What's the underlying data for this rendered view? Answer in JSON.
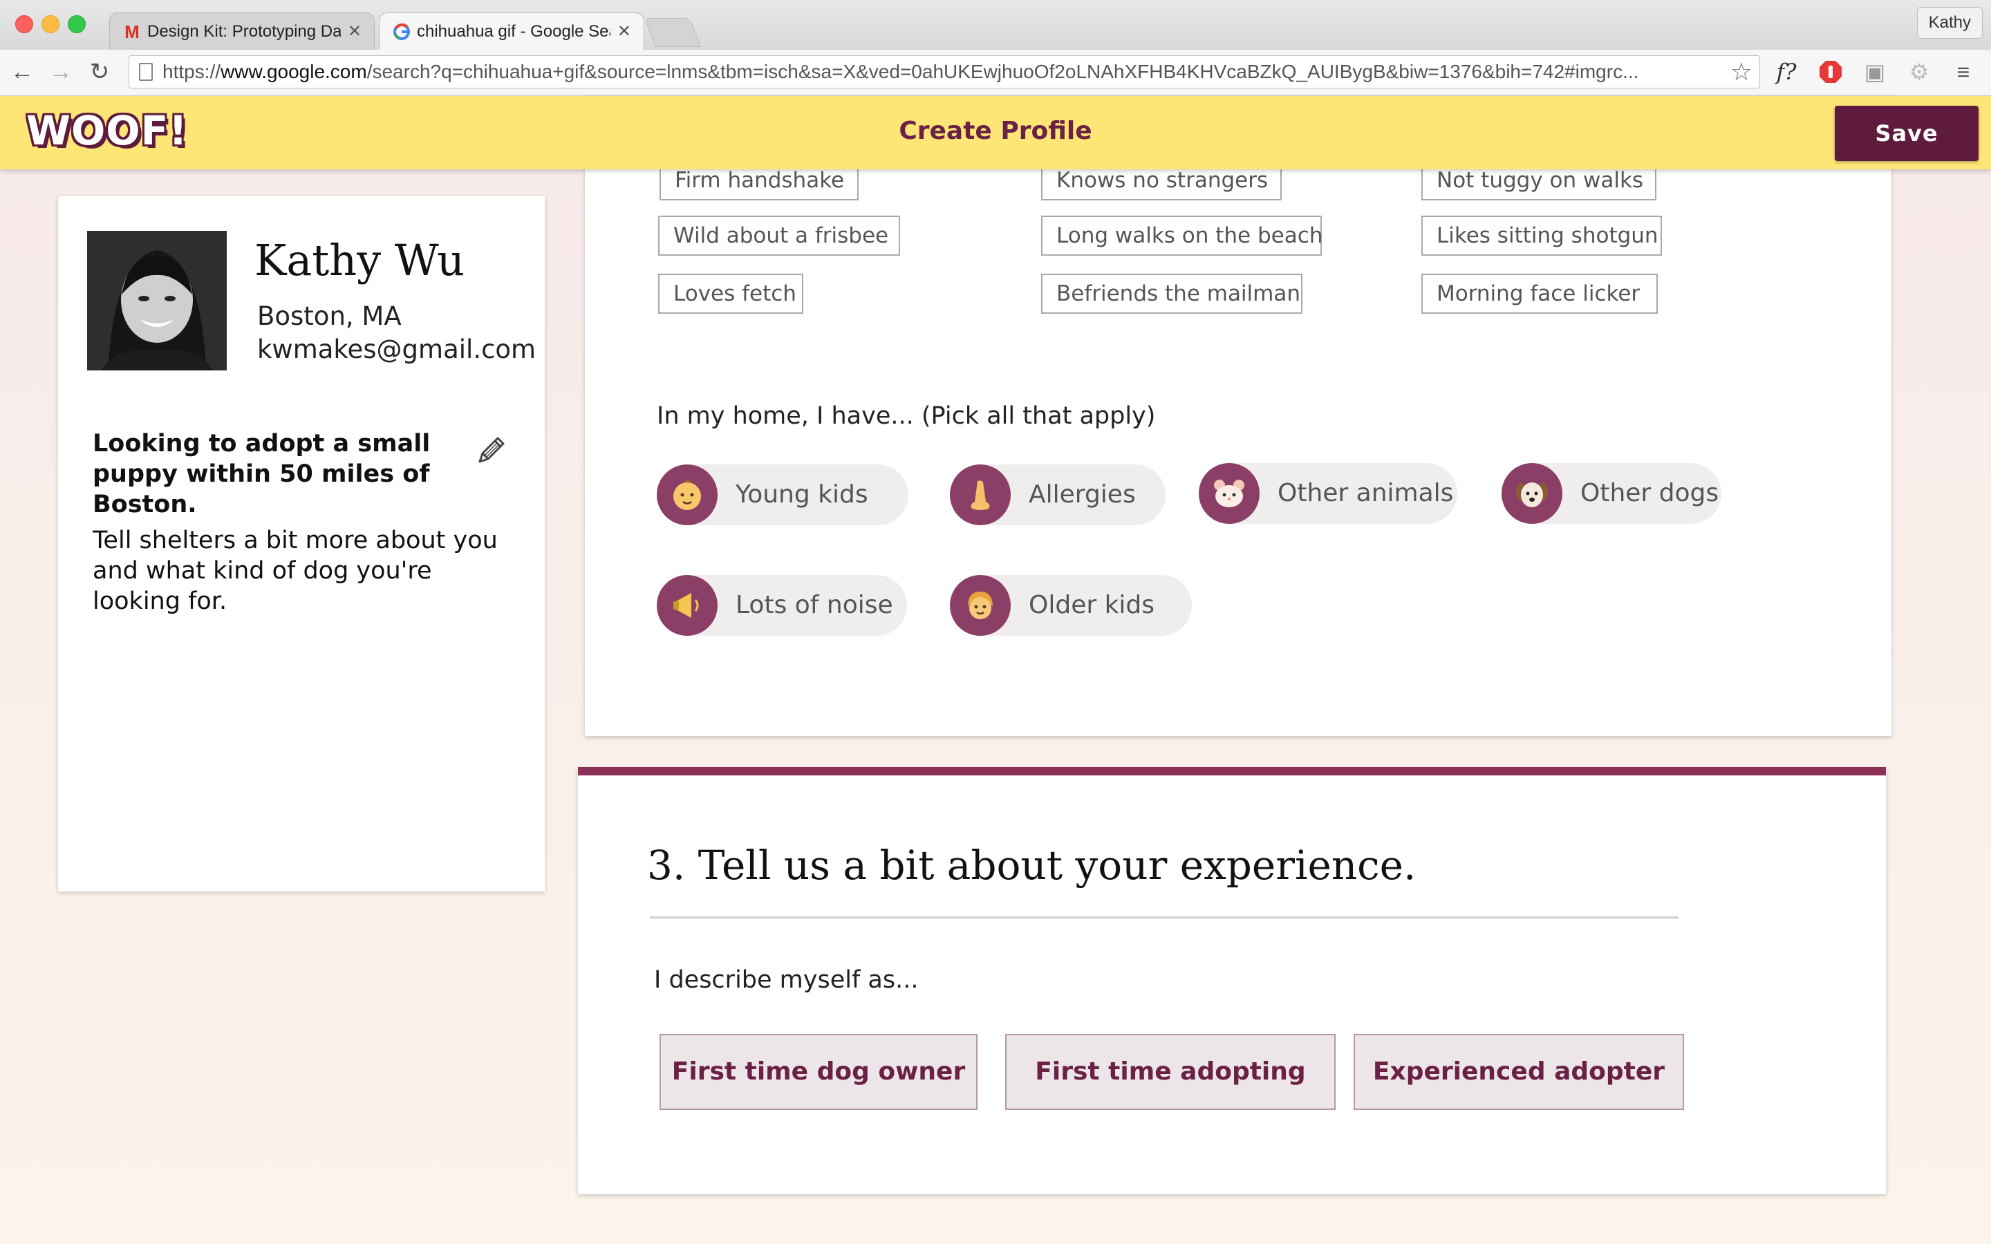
{
  "browser": {
    "tabs": [
      {
        "label": "Design Kit: Prototyping Da",
        "favicon": "gmail-icon",
        "active": false
      },
      {
        "label": "chihuahua gif - Google Sea",
        "favicon": "google-icon",
        "active": true
      }
    ],
    "profile": "Kathy",
    "url_prefix": "https://",
    "url_domain": "www.google.com",
    "url_rest": "/search?q=chihuahua+gif&source=lnms&tbm=isch&sa=X&ved=0ahUKEwjhuoOf2oLNAhXFHB4KHVcaBZkQ_AUIBygB&biw=1376&bih=742#imgrc...",
    "ext_font_label": "f?"
  },
  "app": {
    "logo": "WOOF!",
    "title": "Create Profile",
    "save_label": "Save",
    "accent": "#5e1b3d",
    "header_bg": "#fde676"
  },
  "profile": {
    "name": "Kathy Wu",
    "location": "Boston, MA",
    "email": "kwmakes@gmail.com",
    "looking_for": "Looking to adopt a small puppy within 50 miles of Boston.",
    "tell_more": "Tell shelters a bit more about you and what kind of dog you're looking for."
  },
  "traits": [
    [
      "Firm handshake",
      "Knows no strangers",
      "Not tuggy on walks"
    ],
    [
      "Wild about a frisbee",
      "Long walks on the beach",
      "Likes sitting shotgun"
    ],
    [
      "Loves fetch",
      "Befriends the mailman",
      "Morning face licker"
    ]
  ],
  "home": {
    "question": "In my home, I have... (Pick all that apply)",
    "options": [
      {
        "label": "Young kids",
        "icon": "baby-icon"
      },
      {
        "label": "Allergies",
        "icon": "nose-icon"
      },
      {
        "label": "Other animals",
        "icon": "hamster-icon"
      },
      {
        "label": "Other dogs",
        "icon": "dog-face-icon"
      },
      {
        "label": "Lots of noise",
        "icon": "megaphone-icon"
      },
      {
        "label": "Older kids",
        "icon": "child-icon"
      }
    ]
  },
  "experience": {
    "title": "3. Tell us a bit about your experience.",
    "subtitle": "I describe myself as...",
    "options": [
      "First time dog owner",
      "First time adopting",
      "Experienced adopter"
    ]
  }
}
